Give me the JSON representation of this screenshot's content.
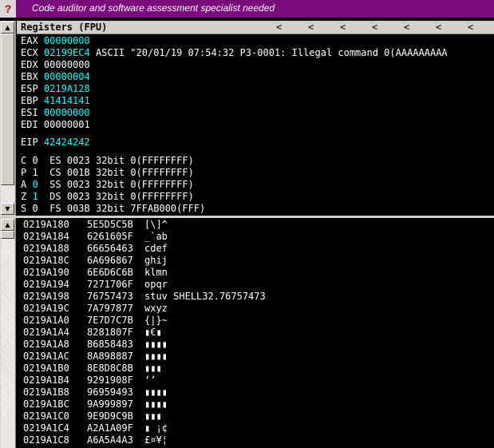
{
  "banner": {
    "help_glyph": "?",
    "message": "Code auditor and software assessment specialist needed"
  },
  "registers_header": {
    "title": "Registers (FPU)",
    "arrows": [
      "<",
      "<",
      "<",
      "<",
      "<",
      "<",
      "<"
    ]
  },
  "registers": [
    {
      "name": "EAX",
      "value": "00000000",
      "highlight": true,
      "comment": ""
    },
    {
      "name": "ECX",
      "value": "02199EC4",
      "highlight": true,
      "comment": "ASCII \"20/01/19 07:54:32 P3-0001: Illegal command 0(AAAAAAAAA"
    },
    {
      "name": "EDX",
      "value": "00000000",
      "highlight": false,
      "comment": ""
    },
    {
      "name": "EBX",
      "value": "00000004",
      "highlight": true,
      "comment": ""
    },
    {
      "name": "ESP",
      "value": "0219A128",
      "highlight": true,
      "comment": ""
    },
    {
      "name": "EBP",
      "value": "41414141",
      "highlight": true,
      "comment": ""
    },
    {
      "name": "ESI",
      "value": "00000000",
      "highlight": true,
      "comment": ""
    },
    {
      "name": "EDI",
      "value": "00000001",
      "highlight": false,
      "comment": ""
    }
  ],
  "eip": {
    "name": "EIP",
    "value": "42424242"
  },
  "flags": [
    {
      "flag": "C",
      "bit": "0",
      "bit_highlight": false,
      "seg": "ES",
      "sel": "0023",
      "bits": "32bit",
      "base": "0(FFFFFFFF)"
    },
    {
      "flag": "P",
      "bit": "1",
      "bit_highlight": false,
      "seg": "CS",
      "sel": "001B",
      "bits": "32bit",
      "base": "0(FFFFFFFF)"
    },
    {
      "flag": "A",
      "bit": "0",
      "bit_highlight": true,
      "seg": "SS",
      "sel": "0023",
      "bits": "32bit",
      "base": "0(FFFFFFFF)"
    },
    {
      "flag": "Z",
      "bit": "1",
      "bit_highlight": true,
      "seg": "DS",
      "sel": "0023",
      "bits": "32bit",
      "base": "0(FFFFFFFF)"
    },
    {
      "flag": "S",
      "bit": "0",
      "bit_highlight": false,
      "seg": "FS",
      "sel": "003B",
      "bits": "32bit",
      "base": "7FFAB000(FFF)"
    }
  ],
  "dump": [
    {
      "addr": "0219A180",
      "hex": "5E5D5C5B",
      "ascii": "[\\]^",
      "comment": ""
    },
    {
      "addr": "0219A184",
      "hex": "6261605F",
      "ascii": "_`ab",
      "comment": ""
    },
    {
      "addr": "0219A188",
      "hex": "66656463",
      "ascii": "cdef",
      "comment": ""
    },
    {
      "addr": "0219A18C",
      "hex": "6A696867",
      "ascii": "ghij",
      "comment": ""
    },
    {
      "addr": "0219A190",
      "hex": "6E6D6C6B",
      "ascii": "klmn",
      "comment": ""
    },
    {
      "addr": "0219A194",
      "hex": "7271706F",
      "ascii": "opqr",
      "comment": ""
    },
    {
      "addr": "0219A198",
      "hex": "76757473",
      "ascii": "stuv",
      "comment": "SHELL32.76757473"
    },
    {
      "addr": "0219A19C",
      "hex": "7A797877",
      "ascii": "wxyz",
      "comment": ""
    },
    {
      "addr": "0219A1A0",
      "hex": "7E7D7C7B",
      "ascii": "{|}~",
      "comment": ""
    },
    {
      "addr": "0219A1A4",
      "hex": "8281807F",
      "ascii": "▮€▮",
      "comment": ""
    },
    {
      "addr": "0219A1A8",
      "hex": "86858483",
      "ascii": "▮▮▮▮",
      "comment": ""
    },
    {
      "addr": "0219A1AC",
      "hex": "8A898887",
      "ascii": "▮▮▮▮",
      "comment": ""
    },
    {
      "addr": "0219A1B0",
      "hex": "8E8D8C8B",
      "ascii": "▮▮▮",
      "comment": ""
    },
    {
      "addr": "0219A1B4",
      "hex": "9291908F",
      "ascii": "‘’",
      "comment": ""
    },
    {
      "addr": "0219A1B8",
      "hex": "96959493",
      "ascii": "▮▮▮▮",
      "comment": ""
    },
    {
      "addr": "0219A1BC",
      "hex": "9A999897",
      "ascii": "▮▮▮▮",
      "comment": ""
    },
    {
      "addr": "0219A1C0",
      "hex": "9E9D9C9B",
      "ascii": "▮▮▮",
      "comment": ""
    },
    {
      "addr": "0219A1C4",
      "hex": "A2A1A09F",
      "ascii": "▮ ¡¢",
      "comment": ""
    },
    {
      "addr": "0219A1C8",
      "hex": "A6A5A4A3",
      "ascii": "£¤¥¦",
      "comment": ""
    }
  ],
  "colors": {
    "banner": "#7b0a7d",
    "highlight": "#00ffff",
    "background": "#000000",
    "text": "#ffffff"
  }
}
